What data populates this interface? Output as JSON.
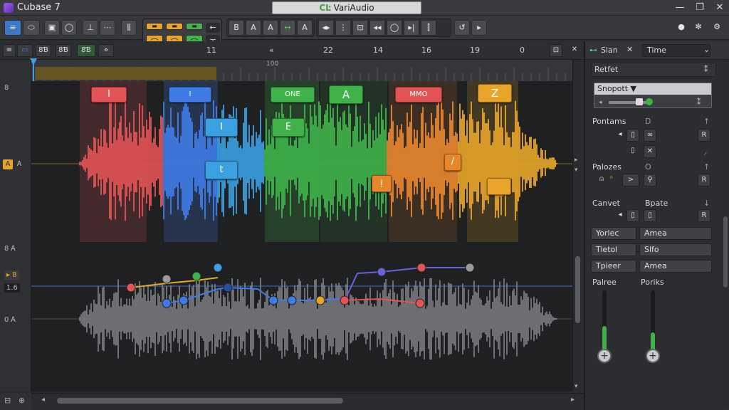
{
  "app": {
    "title": "Cubase 7",
    "document_title": "VariAudio"
  },
  "window_controls": {
    "minimize": "—",
    "maximize": "❐",
    "close": "✕"
  },
  "toolbar": {
    "tool_buttons": [
      "≡",
      "⬭",
      "▣",
      "◯",
      "⊥",
      "⋯",
      "⫼"
    ],
    "transport_tabs": [
      "▬",
      "▬",
      "▬"
    ],
    "transport_buttons": [
      "⌒",
      "⌒",
      "⌒"
    ],
    "transport_side": [
      "←",
      "⊤"
    ],
    "edit_buttons": [
      "B",
      "A",
      "A",
      "↔",
      "A",
      "◂▸",
      "⋮",
      "⊡",
      "◂◂",
      "◯",
      "▸|",
      "⫿",
      "↺",
      "▸"
    ],
    "right_icons": [
      "●",
      "✻",
      "⚙"
    ]
  },
  "ruler": {
    "controls": [
      "≡",
      "▭",
      "8Ɓ",
      "8Ɓ",
      "8Ɓ",
      "⋄"
    ],
    "marks": [
      "11",
      "«",
      "22",
      "14",
      "16",
      "19",
      "0"
    ],
    "timeline_marks": [
      "100"
    ],
    "end_icons": [
      "⊡",
      "✕"
    ]
  },
  "gutter": {
    "items": [
      "8",
      "A",
      "Ꭺ",
      "8 Ꭺ",
      "▸ 8",
      "1.6",
      "0 Ꭺ"
    ]
  },
  "phonemes": [
    "I",
    "I",
    "I",
    "t",
    "ONE",
    "E",
    "A",
    "ᴉ",
    "MMO",
    "Z",
    "∕",
    ""
  ],
  "inspector": {
    "header": {
      "tab1": "Slan",
      "tab2": "Time",
      "close": "✕",
      "menu": "⌄"
    },
    "section_title": "Retfet",
    "snap": {
      "label": "Snopott",
      "arrow": "▼"
    },
    "rows": [
      {
        "label": "Pontams",
        "value": "D"
      },
      {
        "label": "Palozes",
        "value": "O"
      },
      {
        "label": "Canvet",
        "value": "Bpate"
      }
    ],
    "dropdowns": [
      {
        "label": "Yorlec",
        "value": "Amea"
      },
      {
        "label": "Tietol",
        "value": "Slfo"
      },
      {
        "label": "Tpieer",
        "value": "Amea"
      }
    ],
    "faders": [
      {
        "label": "Palree",
        "level": 0.45
      },
      {
        "label": "Poriks",
        "level": 0.35
      }
    ]
  },
  "colors": {
    "red": "#e25456",
    "blue": "#3f7be6",
    "cyan": "#3aa0e0",
    "green": "#3fb34a",
    "orange": "#e8862c",
    "yellow": "#e8a52a",
    "waveform_gray": "#7b7c7f"
  }
}
